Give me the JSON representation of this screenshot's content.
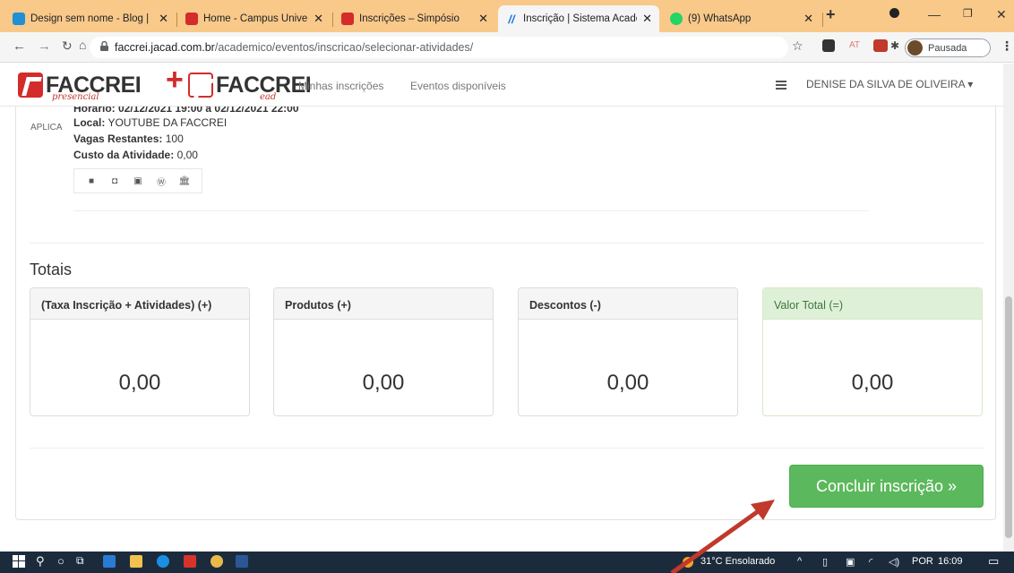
{
  "browser": {
    "tabs": [
      {
        "title": "Design sem nome - Blog |",
        "favicon_color": "#1f8fd6"
      },
      {
        "title": "Home - Campus Universit",
        "favicon_color": "#d42b2b"
      },
      {
        "title": "Inscrições – Simpósio",
        "favicon_color": "#d42b2b"
      },
      {
        "title": "Inscrição | Sistema Acadê",
        "favicon_color": "#1a73e8",
        "active": true
      },
      {
        "title": "(9) WhatsApp",
        "favicon_color": "#25d366"
      }
    ],
    "new_tab": "+",
    "url_host": "faccrei.jacad.com.br",
    "url_path": "/academico/eventos/inscricao/selecionar-atividades/",
    "profile_status": "Pausada",
    "ext_at": "AT"
  },
  "site": {
    "logo_left": {
      "word": "FACCREI",
      "sub": "presencial"
    },
    "plus": "+",
    "logo_right": {
      "word": "FACCREI",
      "sub": "ead"
    },
    "nav": [
      "Minhas inscrições",
      "Eventos disponíveis"
    ],
    "user_name": "DENISE DA SILVA DE OLIVEIRA ▾"
  },
  "activity": {
    "tag": "APLICA",
    "horario_cut": "Horário: 02/12/2021 19:00 à 02/12/2021 22:00",
    "local_label": "Local:",
    "local_value": "YOUTUBE DA FACCREI",
    "vagas_label": "Vagas Restantes:",
    "vagas_value": "100",
    "custo_label": "Custo da Atividade:",
    "custo_value": "0,00"
  },
  "totals": {
    "title": "Totais",
    "cards": [
      {
        "label": "(Taxa Inscrição + Atividades) (+)",
        "value": "0,00"
      },
      {
        "label": "Produtos (+)",
        "value": "0,00"
      },
      {
        "label": "Descontos (-)",
        "value": "0,00"
      },
      {
        "label": "Valor Total (=)",
        "value": "0,00"
      }
    ]
  },
  "conclude_button": "Concluir inscrição »",
  "taskbar": {
    "weather": "31°C  Ensolarado",
    "lang": "POR",
    "time": "16:09"
  },
  "colors": {
    "accent_green": "#5cb85c",
    "brand_red": "#d42b2b",
    "taskbar": "#1c2b3c",
    "tabbar": "#f9c98a"
  }
}
